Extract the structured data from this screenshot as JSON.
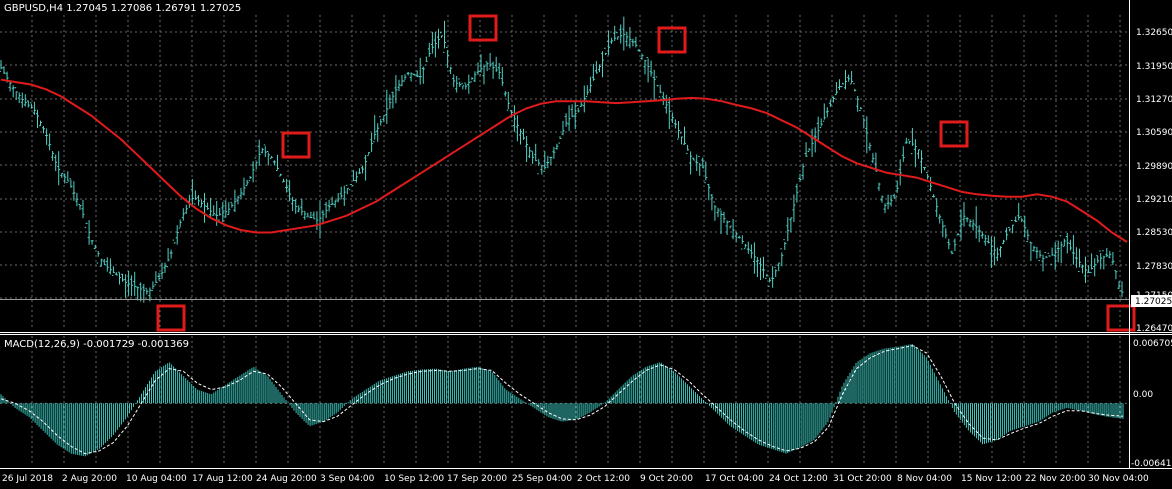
{
  "main_panel": {
    "header": "GBPUSD,H4  1.27045 1.27086 1.26791 1.27025",
    "price_labels": [
      "1.32650",
      "1.31950",
      "1.31270",
      "1.30590",
      "1.29890",
      "1.29210",
      "1.28530",
      "1.27830",
      "1.27150",
      "1.26470"
    ],
    "current_price": "1.27025"
  },
  "macd_panel": {
    "header": "MACD(12,26,9) -0.001729 -0.001369",
    "labels": [
      "0.006705",
      "0.00",
      "-0.006411"
    ]
  },
  "time_labels": [
    "26 Jul 2018",
    "2 Aug 20:00",
    "10 Aug 04:00",
    "17 Aug 12:00",
    "24 Aug 20:00",
    "3 Sep 04:00",
    "10 Sep 12:00",
    "17 Sep 20:00",
    "25 Sep 04:00",
    "2 Oct 12:00",
    "9 Oct 20:00",
    "17 Oct 04:00",
    "24 Oct 12:00",
    "31 Oct 20:00",
    "8 Nov 04:00",
    "15 Nov 12:00",
    "22 Nov 20:00",
    "30 Nov 04:00"
  ],
  "colors": {
    "background": "#000000",
    "grid": "#6a6a6a",
    "price_bars": "#4fd1c5",
    "moving_average": "#e01b1b",
    "marker_boxes": "#e01b1b",
    "histogram": "#3cc8c0",
    "signal_line": "#ffffff"
  },
  "chart_data": [
    {
      "type": "bar",
      "series": [
        {
          "values": [
            1.319,
            1.315,
            1.312,
            1.31,
            1.305,
            1.298,
            1.295,
            1.29,
            1.283,
            1.278,
            1.276,
            1.274,
            1.273,
            1.272,
            1.275,
            1.28,
            1.288,
            1.292,
            1.29,
            1.288,
            1.289,
            1.292,
            1.296,
            1.302,
            1.3,
            1.295,
            1.29,
            1.288,
            1.287,
            1.29,
            1.292,
            1.295,
            1.298,
            1.305,
            1.31,
            1.315,
            1.318,
            1.317,
            1.323,
            1.326,
            1.316,
            1.315,
            1.318,
            1.32,
            1.318,
            1.31,
            1.305,
            1.3,
            1.298,
            1.302,
            1.308,
            1.31,
            1.315,
            1.32,
            1.325,
            1.326,
            1.324,
            1.32,
            1.315,
            1.31,
            1.305,
            1.3,
            1.298,
            1.29,
            1.287,
            1.284,
            1.281,
            1.278,
            1.274,
            1.28,
            1.29,
            1.3,
            1.305,
            1.31,
            1.315,
            1.317,
            1.31,
            1.3,
            1.29,
            1.292,
            1.304,
            1.302,
            1.295,
            1.287,
            1.28,
            1.288,
            1.286,
            1.283,
            1.28,
            1.285,
            1.288,
            1.282,
            1.279,
            1.28,
            1.283,
            1.279,
            1.276,
            1.279,
            1.28,
            1.272
          ]
        },
        {
          "values": [
            1.3165,
            1.316,
            1.3155,
            1.3145,
            1.313,
            1.311,
            1.309,
            1.3065,
            1.304,
            1.301,
            1.298,
            1.295,
            1.292,
            1.2895,
            1.2875,
            1.286,
            1.285,
            1.2845,
            1.2845,
            1.285,
            1.2855,
            1.286,
            1.287,
            1.288,
            1.2895,
            1.291,
            1.293,
            1.295,
            1.297,
            1.299,
            1.301,
            1.303,
            1.305,
            1.307,
            1.309,
            1.3105,
            1.3115,
            1.312,
            1.312,
            1.312,
            1.3118,
            1.3116,
            1.3118,
            1.312,
            1.3122,
            1.3125,
            1.3127,
            1.3125,
            1.312,
            1.3112,
            1.3105,
            1.3095,
            1.308,
            1.3065,
            1.3045,
            1.3025,
            1.3005,
            1.299,
            1.298,
            1.297,
            1.2965,
            1.296,
            1.295,
            1.294,
            1.293,
            1.2925,
            1.2922,
            1.292,
            1.292,
            1.2925,
            1.292,
            1.291,
            1.289,
            1.287,
            1.2845,
            1.2825
          ]
        }
      ],
      "ylim": [
        1.2647,
        1.3265
      ]
    },
    {
      "type": "bar",
      "series": [
        {
          "values": [
            0.001,
            -0.0005,
            -0.0015,
            -0.003,
            -0.0045,
            -0.0055,
            -0.0058,
            -0.005,
            -0.0035,
            -0.0015,
            0.001,
            0.0035,
            0.0045,
            0.003,
            0.0015,
            0.001,
            0.002,
            0.003,
            0.004,
            0.003,
            0.001,
            -0.001,
            -0.0025,
            -0.002,
            -0.001,
            0.0005,
            0.0015,
            0.0025,
            0.003,
            0.0035,
            0.0037,
            0.0038,
            0.0035,
            0.0038,
            0.004,
            0.0035,
            0.0015,
            0.0005,
            -0.0005,
            -0.0015,
            -0.002,
            -0.0018,
            -0.001,
            0.0,
            0.0015,
            0.003,
            0.004,
            0.0045,
            0.0035,
            0.002,
            0.0005,
            -0.001,
            -0.0025,
            -0.0035,
            -0.0045,
            -0.005,
            -0.0055,
            -0.0048,
            -0.004,
            -0.002,
            0.002,
            0.0045,
            0.0055,
            0.006,
            0.0062,
            0.0065,
            0.005,
            0.002,
            -0.001,
            -0.003,
            -0.0045,
            -0.004,
            -0.003,
            -0.0025,
            -0.002,
            -0.001,
            -0.0005,
            -0.0008,
            -0.0012,
            -0.0015,
            -0.0017
          ]
        },
        {
          "values": [
            0.0005,
            0.0,
            -0.0008,
            -0.002,
            -0.0035,
            -0.0047,
            -0.0055,
            -0.0052,
            -0.0043,
            -0.0025,
            0.0,
            0.0025,
            0.0038,
            0.0035,
            0.0022,
            0.0015,
            0.0018,
            0.0025,
            0.0035,
            0.0032,
            0.0018,
            0.0,
            -0.0018,
            -0.002,
            -0.0014,
            -0.0002,
            0.001,
            0.002,
            0.0027,
            0.0032,
            0.0035,
            0.0036,
            0.0035,
            0.0036,
            0.0038,
            0.0036,
            0.0022,
            0.001,
            0.0,
            -0.001,
            -0.0017,
            -0.0018,
            -0.0013,
            -0.0004,
            0.001,
            0.0024,
            0.0036,
            0.0042,
            0.0037,
            0.0025,
            0.001,
            -0.0004,
            -0.0018,
            -0.003,
            -0.004,
            -0.0047,
            -0.0052,
            -0.0049,
            -0.0042,
            -0.0026,
            0.001,
            0.0038,
            0.005,
            0.0057,
            0.006,
            0.0063,
            0.0055,
            0.003,
            0.0,
            -0.0022,
            -0.0038,
            -0.004,
            -0.0033,
            -0.0027,
            -0.0022,
            -0.0014,
            -0.0008,
            -0.0008,
            -0.0011,
            -0.0013,
            -0.0014
          ]
        }
      ],
      "ylim": [
        -0.006411,
        0.006705
      ]
    }
  ]
}
